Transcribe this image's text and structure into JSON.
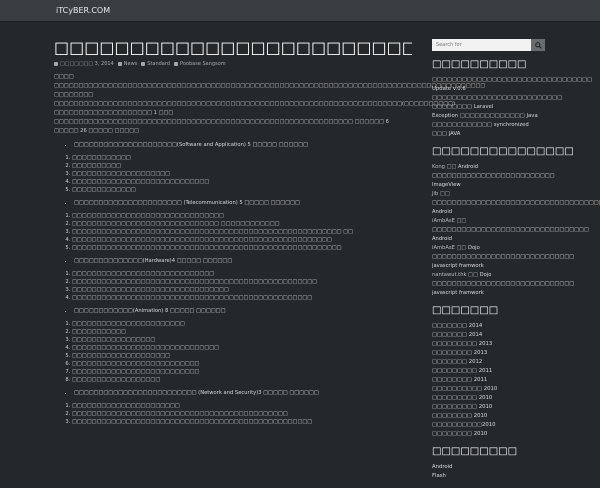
{
  "site": {
    "title": "iTCyBER.COM"
  },
  "post": {
    "title": "□□□□□□□□□□□□□□□□□□□□□□□□□□□□□□□□",
    "meta": {
      "date": "□□□□□□□ 3, 2014",
      "category": "News",
      "format": "Standard",
      "author": "Poobase Sangsom"
    },
    "intro": "□□□□ □□□□□□□□□□□□□□□□□□□□□□□□□□□□□□□□□□□□□□□□□□□□□□□□□□□□□□□□□□□□□□□□□□□□□□□□□□□□□□□□□□□□□□□□ □□□□□□□□ □□□□□□□□□□□□□□□□□□□□□□□□□□□□□□□□□□□□□□□□□□□□□□□□□□□□□□□□□□□□□□□□□□□□□□□(□□□□□□□□□□) □□□□□□□□□□□□□□□□□□□□ 1 □□□ □□□□□□□□□□□□□□□□□□□□□□□□□□□□□□□□□□□□□□□□□□□□□□□□□□□□□□□□□□□□□ □□□□□□ 6 □□□□□ 26 □□□□□ □□□□□",
    "sections": [
      {
        "heading": "□□□□□□□□□□□□□□□□□□□□□(Software and Application) 5 □□□□□ □□□□□□",
        "items": [
          "□□□□□□□□□□□□",
          "□□□□□□□□□□",
          "□□□□□□□□□□□□□□□□□□□□",
          "□□□□□□□□□□□□□□□□□□□□□□□□□□□□",
          "□□□□□□□□□□□□□"
        ]
      },
      {
        "heading": "□□□□□□□□□□□□□□□□□□□□□□ (Telecommunication) 5 □□□□□ □□□□□□",
        "items": [
          "□□□□□□□□□□□□□□□□□□□□□□□□□□□□□□□",
          "□□□□□□□□□□□□□□□□□□□□□□□□□□□□□□ □□□□□□□□□□□□",
          "□□□□□□□□□□□□□□□□□□□□□□□□□□□□□□□□□□□□□□□□□□□□□□□□□□□□□□□ □□",
          "□□□□□□□□□□□□□□□□□□□□□□□□□□□□□□□□□□□□□□□□□□□□□□□□□□□□□",
          "□□□□□□□□□□□□□□□□□□□□□□□□□□□□□□□□□□□□□□□□□□□□□□□□□□□□□□□"
        ]
      },
      {
        "heading": "□□□□□□□□□□□□□□(Hardware)4 □□□□□ □□□□□□",
        "items": [
          "□□□□□□□□□□□□□□□□□□□□□□□□□□□□□",
          "□□□□□□□□□□□□□□□□□□□□□□□□□□□□□□□□□□□□□□□□□□□□□□□□□□",
          "□□□□□□□□□□□□□□□□□□□□□□□□□□□□□□□□",
          "□□□□□□□□□□□□□□□□□□□□□□□□□□□□□□□□□□□□□□□□□□□□□□□□□"
        ]
      },
      {
        "heading": "□□□□□□□□□□□□(Animation) 8 □□□□□ □□□□□□",
        "items": [
          "□□□□□□□□□□□□□□□□□□□□□□□",
          "□□□□□□□□□□□",
          "□□□□□□□□□□□□□□□□□",
          "□□□□□□□□□□□□□□□□□□□□□□□□□□□□□□",
          "□□□□□□□□□□□□□□□□□□□□",
          "□□□□□□□□□□□□□□□□□□□□□□□□□□",
          "□□□□□□□□□□□□□□□□□□□□□□□□□□",
          "□□□□□□□□□□□□□□□□□□"
        ]
      },
      {
        "heading": "□□□□□□□□□□□□□□□□□□□□□□□□□ (Network and Security)3 □□□□□ □□□□□□",
        "items": [
          "□□□□□□□□□□□□□□□□□□□□□□",
          "□□□□□□□□□□□□□□□□□□□□□□□□□□□□□□□□□□□□□□□□□□□□",
          "□□□□□□□□□□□□□□□□□□□□□□□□□□□□□□□□□□□□□□□□□□□□□□□□□"
        ]
      }
    ]
  },
  "search": {
    "placeholder": "Search for"
  },
  "widgets": {
    "recent": {
      "title": "□□□□□□□□□□",
      "items": [
        "□□□□□□□□□□□□□□□□□□□□□□□□□□□□□□□□ Update v.0.6 □□□□□□□□□□□□□□□□□□□□□□□□□□",
        "□□□□□□□□ Laravel",
        "Exception □□□□□□□□□□□□□ Java",
        "□□□□□□□□□□□□ synchronized □□□ JAVA"
      ]
    },
    "comments": {
      "title": "□□□□□□□□□□□□□□□",
      "items": [
        {
          "user": "Kong",
          "word": "□□",
          "text": "Android □□□□□□□□□□□□□□□□□□□□□□□□□ ImageView"
        },
        {
          "user": "Jib",
          "word": "□□",
          "text": "□□□□□□□□□□□□□□□□□□□□□□□□□□□□□□□□□□□□□□□ Android"
        },
        {
          "user": "iAmbAsE",
          "word": "□□",
          "text": "□□□□□□□□□□□□□□□□□□□□□□□□□□□□□□□□ Android"
        },
        {
          "user": "iAmbAsE",
          "word": "□□",
          "text": "Dojo □□□□□□□□□□□□□□□□□□□□□□□□□□□□□ javascript framwork"
        },
        {
          "user": "nantawut.thk",
          "word": "□□",
          "text": "Dojo □□□□□□□□□□□□□□□□□□□□□□□□□□□□□ javascript framwork"
        }
      ]
    },
    "archives": {
      "title": "□□□□□□□",
      "items": [
        "□□□□□□□ 2014",
        "□□□□□□□ 2014",
        "□□□□□□□□□ 2013",
        "□□□□□□□□ 2013",
        "□□□□□□□ 2012",
        "□□□□□□□□□ 2011",
        "□□□□□□□□ 2011",
        "□□□□□□□□□□ 2010",
        "□□□□□□□□□ 2010",
        "□□□□□□□□□ 2010",
        "□□□□□□□□ 2010",
        "□□□□□□□□□□2010",
        "□□□□□□□□ 2010"
      ]
    },
    "categories": {
      "title": "□□□□□□□□□",
      "items": [
        "Android",
        "Flash"
      ]
    }
  }
}
